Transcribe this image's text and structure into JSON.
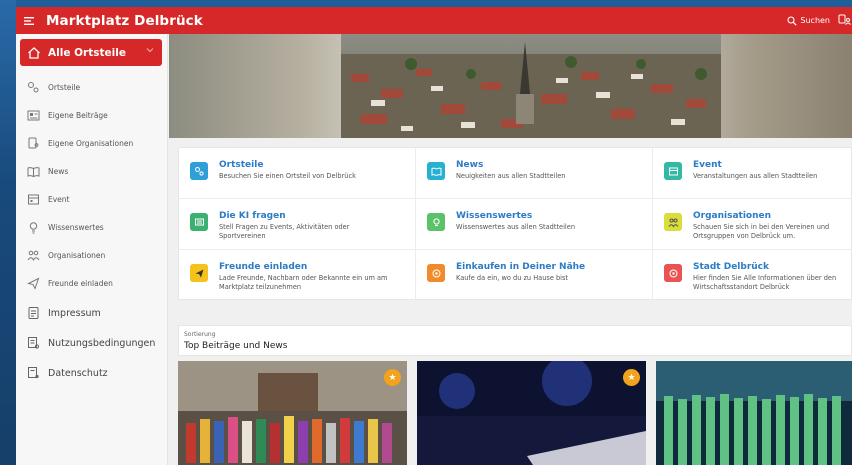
{
  "app": {
    "title": "Marktplatz Delbrück",
    "search_label": "Suchen",
    "accent": "#d62828"
  },
  "sidebar": {
    "active_label": "Alle Ortsteile",
    "items": [
      {
        "label": "Ortsteile",
        "icon": "map-pin-icon"
      },
      {
        "label": "Eigene Beiträge",
        "icon": "newspaper-icon"
      },
      {
        "label": "Eigene Organisationen",
        "icon": "org-icon"
      },
      {
        "label": "News",
        "icon": "book-icon"
      },
      {
        "label": "Event",
        "icon": "calendar-icon"
      },
      {
        "label": "Wissenswertes",
        "icon": "lightbulb-icon"
      },
      {
        "label": "Organisationen",
        "icon": "people-icon"
      },
      {
        "label": "Freunde einladen",
        "icon": "send-icon"
      },
      {
        "label": "Impressum",
        "icon": "document-icon"
      },
      {
        "label": "Nutzungsbedingungen",
        "icon": "terms-icon"
      },
      {
        "label": "Datenschutz",
        "icon": "privacy-icon"
      }
    ]
  },
  "cards": [
    {
      "title": "Ortsteile",
      "desc": "Besuchen Sie einen Ortsteil von Delbrück",
      "color": "#2f9fd8",
      "icon": "map-pin-icon"
    },
    {
      "title": "News",
      "desc": "Neuigkeiten aus allen Stadtteilen",
      "color": "#27b0cf",
      "icon": "book-icon"
    },
    {
      "title": "Event",
      "desc": "Veranstaltungen aus allen Stadtteilen",
      "color": "#33b8a5",
      "icon": "calendar-icon"
    },
    {
      "title": "Die KI fragen",
      "desc": "Stell Fragen zu Events, Aktivitäten oder Sportvereinen",
      "color": "#3cb070",
      "icon": "chat-icon"
    },
    {
      "title": "Wissenswertes",
      "desc": "Wissenswertes aus allen Stadtteilen",
      "color": "#5cc26a",
      "icon": "lightbulb-icon"
    },
    {
      "title": "Organisationen",
      "desc": "Schauen Sie sich in bei den Vereinen und Ortsgruppen von Delbrück um.",
      "color": "#d9de3a",
      "icon": "people-icon"
    },
    {
      "title": "Freunde einladen",
      "desc": "Lade Freunde, Nachbarn oder Bekannte ein um am Marktplatz teilzunehmen",
      "color": "#f5c21b",
      "icon": "send-icon"
    },
    {
      "title": "Einkaufen in Deiner Nähe",
      "desc": "Kaufe da ein, wo du zu Hause bist",
      "color": "#f08a2a",
      "icon": "shop-icon"
    },
    {
      "title": "Stadt Delbrück",
      "desc": " Hier finden Sie Alle Informationen über den Wirtschaftsstandort Delbrück",
      "color": "#e85454",
      "icon": "city-icon"
    }
  ],
  "sort": {
    "label": "Sortierung",
    "value": "Top Beiträge und News"
  }
}
